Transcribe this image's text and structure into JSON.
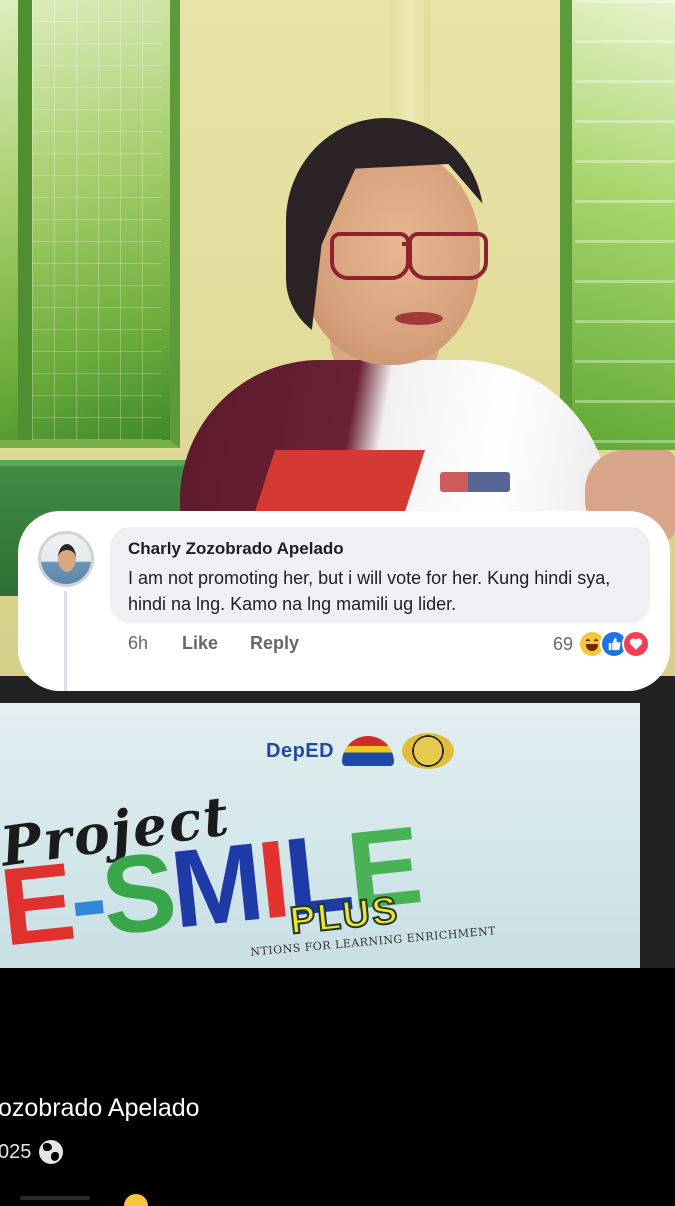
{
  "comment": {
    "author": "Charly Zozobrado Apelado",
    "text": "I am not promoting her, but i will vote for her. Kung hindi sya, hindi na lng. Kamo na lng mamili ug lider.",
    "time": "6h",
    "like_label": "Like",
    "reply_label": "Reply",
    "reaction_count": "69",
    "reactions": [
      "haha-icon",
      "like-icon",
      "love-icon"
    ]
  },
  "slide": {
    "deped_logo": "DepED",
    "project_word": "Project",
    "smile_word": "E-SMILE",
    "plus_word": "PLUS",
    "subtitle": "NTIONS FOR LEARNING ENRICHMENT"
  },
  "post": {
    "author_partial": "ozobrado Apelado",
    "date_partial": "025",
    "privacy_icon": "globe-icon"
  },
  "colors": {
    "reaction_like": "#1b74e4",
    "reaction_love": "#f33e58",
    "reaction_haha": "#f7c63b",
    "bubble_bg": "#eef0f3"
  }
}
